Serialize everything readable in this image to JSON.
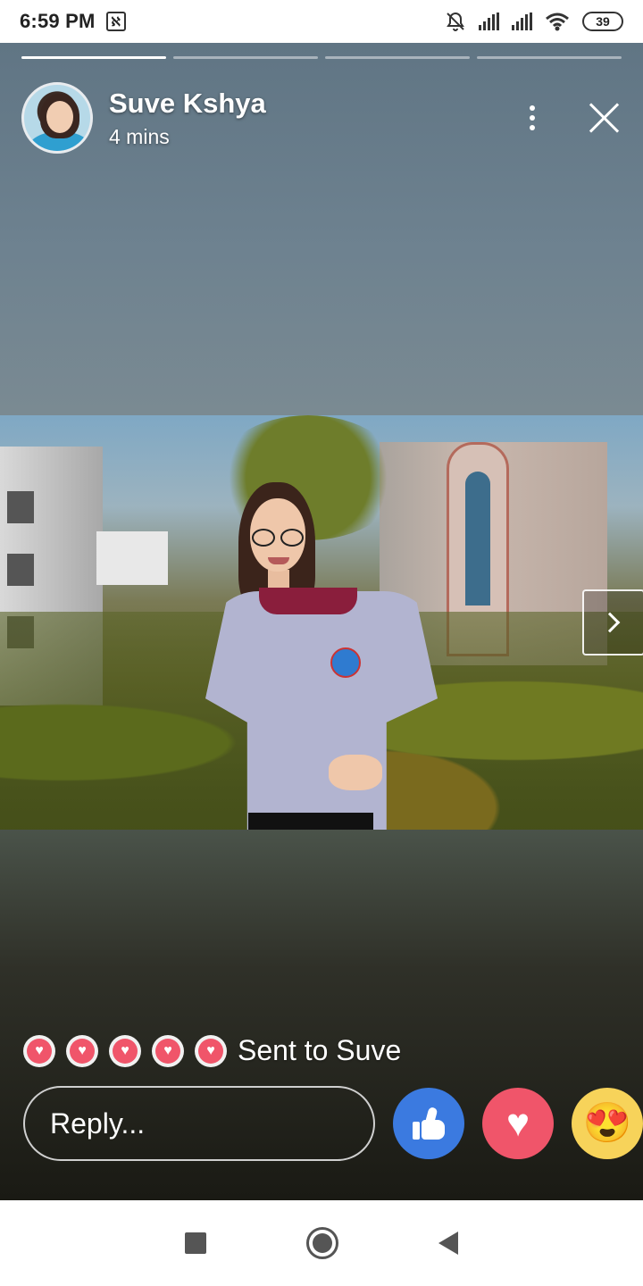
{
  "status_bar": {
    "time": "6:59 PM",
    "notification_icon": "app-notification-icon",
    "battery": "39",
    "icons": [
      "muted-bell-icon",
      "signal-icon",
      "signal-icon",
      "wifi-icon",
      "battery-icon"
    ]
  },
  "story": {
    "progress_segments": 4,
    "active_segment": 1,
    "user_name": "Suve Kshya",
    "time_ago": "4 mins",
    "icons": {
      "more": "more-vertical-icon",
      "close": "close-icon",
      "next": "chevron-right-icon"
    }
  },
  "reactions": {
    "sent_hearts_count": 5,
    "sent_text": "Sent to Suve",
    "reply_placeholder": "Reply...",
    "buttons": [
      "like-icon",
      "love-icon",
      "care-icon"
    ],
    "colors": {
      "like": "#3b7ae0",
      "love": "#f0556a",
      "care": "#f7d35a"
    }
  },
  "nav_bar": {
    "buttons": [
      "recent-apps-icon",
      "home-icon",
      "back-icon"
    ]
  }
}
